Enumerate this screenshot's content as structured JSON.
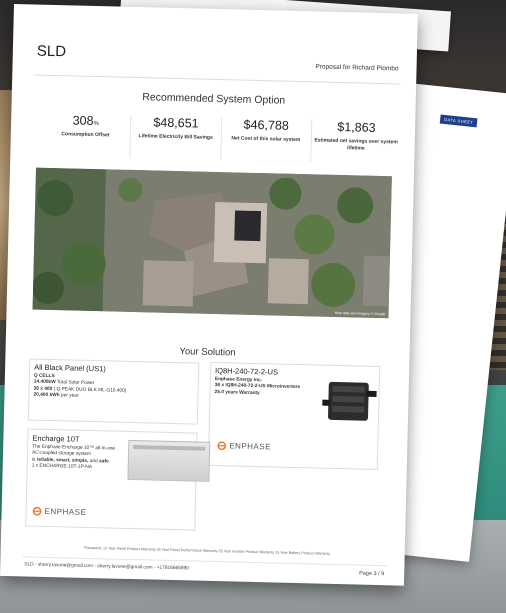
{
  "back_sheet": {
    "tag": "DATA SHEET"
  },
  "header": {
    "title": "SLD",
    "proposal": "Proposal for Richard Piombo"
  },
  "recommended": {
    "title": "Recommended System Option",
    "metrics": [
      {
        "value": "308",
        "unit": "%",
        "label": "Consumption Offset"
      },
      {
        "value": "$48,651",
        "unit": "",
        "label": "Lifetime Electricity Bill Savings"
      },
      {
        "value": "$46,788",
        "unit": "",
        "label": "Net Cost of this solar system"
      },
      {
        "value": "$1,863",
        "unit": "",
        "label": "Estimated net savings over system lifetime"
      }
    ]
  },
  "aerial": {
    "credit": "Map data and imagery © Google"
  },
  "solution": {
    "title": "Your Solution",
    "panel": {
      "title": "All Black Panel (US1)",
      "brand": "Q CELLS",
      "power_value": "14.400kW",
      "power_label": " Total Solar Power",
      "model_count": "36 x 400",
      "model_name": " ( Q.PEAK DUO BLK ML-G10.400)",
      "warranty_value": "20,400 kWh",
      "warranty_label": " per year"
    },
    "inverter": {
      "title": "IQ8H-240-72-2-US",
      "brand": "Enphase Energy Inc.",
      "model": "36 x IQ8H-240-72-2-US Microinverters",
      "warranty": "25.0 years Warranty",
      "logo": "ENPHASE"
    },
    "battery": {
      "title": "Encharge 10T",
      "desc1": "The Enphase Encharge 10™ all-in-one",
      "desc2": "AC-coupled storage system",
      "desc3_pre": "is ",
      "desc3_b1": "reliable, smart, simple,",
      "desc3_mid": " and ",
      "desc3_b2": "safe",
      "desc3_end": ".",
      "qty": "1 x ENCHARGE-10T-1P-NA",
      "logo": "ENPHASE"
    }
  },
  "footer": {
    "disclaimer": "*Panasonic 12 Year Panel Product Warranty 25 Year Panel Performance Warranty 25 Year Inverter Product Warranty 15 Year Battery Product Warranty",
    "contact": "SLD - sherry.lavone@gmail.com - sherry.lavone@gmail.com - +17816665890",
    "page": "Page 3 / 9"
  },
  "colors": {
    "enphase_orange": "#f37321",
    "tag_blue": "#1f3f8a"
  }
}
